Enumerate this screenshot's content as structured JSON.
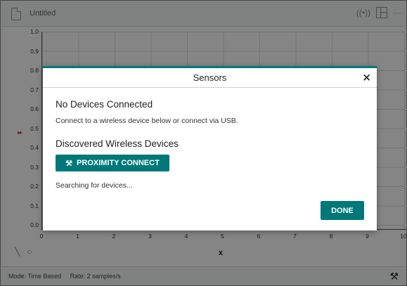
{
  "app": {
    "doc_title": "Untitled",
    "header_icons": [
      "wireless-icon",
      "layout-icon",
      "more-icon"
    ],
    "more_glyph": "···",
    "wireless_glyph": "((•))"
  },
  "graph": {
    "y_ticks": [
      "1.0",
      "0.9",
      "0.8",
      "0.7",
      "0.6",
      "0.5",
      "0.4",
      "0.3",
      "0.2",
      "0.1",
      "0.0"
    ],
    "x_ticks": [
      "0",
      "1",
      "2",
      "3",
      "4",
      "5",
      "6",
      "7",
      "8",
      "9",
      "10"
    ],
    "x_label": "x",
    "y_marker": "▸▸"
  },
  "toolbar": {
    "icons": [
      "graph-settings-icon",
      "zoom-icon"
    ],
    "graph_glyph": "╲",
    "zoom_glyph": "○"
  },
  "status": {
    "mode": "Mode: Time Based",
    "rate": "Rate: 2 samples/s",
    "wrench_glyph": "⚒"
  },
  "dialog": {
    "title": "Sensors",
    "close_glyph": "×",
    "no_devices_heading": "No Devices Connected",
    "connect_hint": "Connect to a wireless device below or connect via USB.",
    "discovered_heading": "Discovered Wireless Devices",
    "proximity_button": "PROXIMITY CONNECT",
    "proximity_glyph": "⚒",
    "searching_text": "Searching for devices...",
    "done_button": "DONE"
  },
  "colors": {
    "accent": "#00787a",
    "overlay": "rgba(0,0,0,0.48)"
  }
}
